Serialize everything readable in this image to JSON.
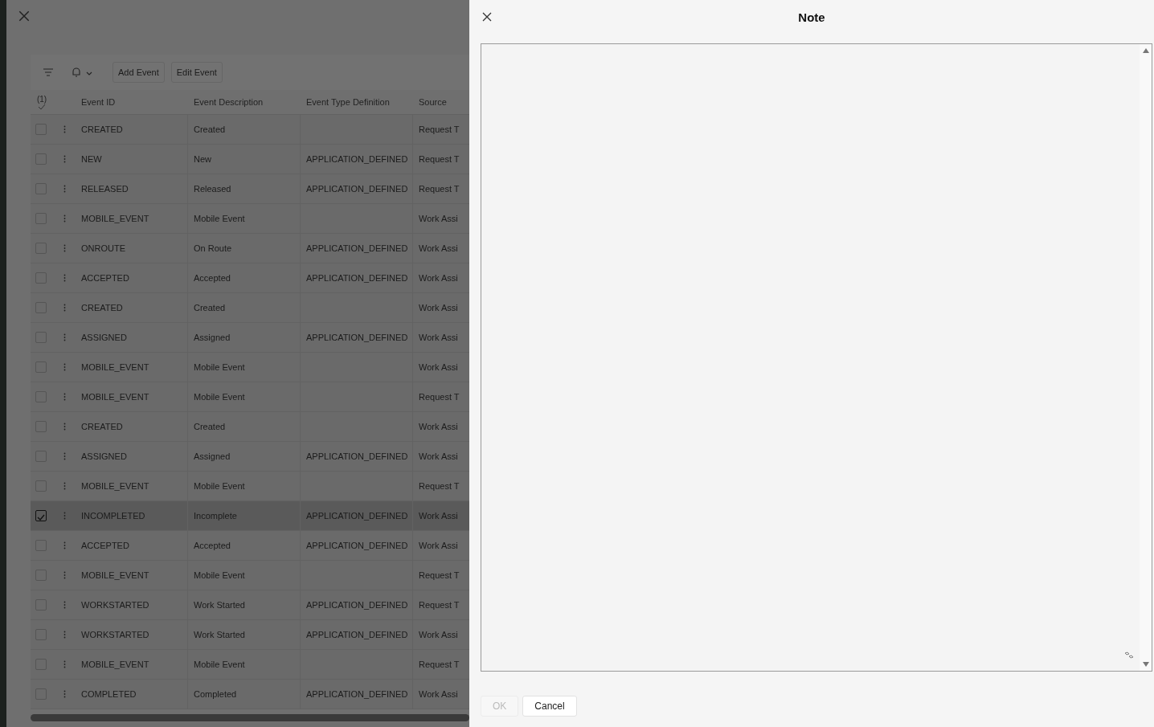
{
  "background_panel": {
    "toolbar": {
      "buttons": [
        "Add Event",
        "Edit Event"
      ]
    },
    "table": {
      "selection_count": "(1)",
      "columns": [
        "Event ID",
        "Event Description",
        "Event Type Definition",
        "Source"
      ],
      "rows": [
        {
          "event_id": "CREATED",
          "description": "Created",
          "type": "",
          "source": "Request T",
          "selected": false
        },
        {
          "event_id": "NEW",
          "description": "New",
          "type": "APPLICATION_DEFINED",
          "source": "Request T",
          "selected": false
        },
        {
          "event_id": "RELEASED",
          "description": "Released",
          "type": "APPLICATION_DEFINED",
          "source": "Request T",
          "selected": false
        },
        {
          "event_id": "MOBILE_EVENT",
          "description": "Mobile Event",
          "type": "",
          "source": "Work Assi",
          "selected": false
        },
        {
          "event_id": "ONROUTE",
          "description": "On Route",
          "type": "APPLICATION_DEFINED",
          "source": "Work Assi",
          "selected": false
        },
        {
          "event_id": "ACCEPTED",
          "description": "Accepted",
          "type": "APPLICATION_DEFINED",
          "source": "Work Assi",
          "selected": false
        },
        {
          "event_id": "CREATED",
          "description": "Created",
          "type": "",
          "source": "Work Assi",
          "selected": false
        },
        {
          "event_id": "ASSIGNED",
          "description": "Assigned",
          "type": "APPLICATION_DEFINED",
          "source": "Work Assi",
          "selected": false
        },
        {
          "event_id": "MOBILE_EVENT",
          "description": "Mobile Event",
          "type": "",
          "source": "Work Assi",
          "selected": false
        },
        {
          "event_id": "MOBILE_EVENT",
          "description": "Mobile Event",
          "type": "",
          "source": "Request T",
          "selected": false
        },
        {
          "event_id": "CREATED",
          "description": "Created",
          "type": "",
          "source": "Work Assi",
          "selected": false
        },
        {
          "event_id": "ASSIGNED",
          "description": "Assigned",
          "type": "APPLICATION_DEFINED",
          "source": "Work Assi",
          "selected": false
        },
        {
          "event_id": "MOBILE_EVENT",
          "description": "Mobile Event",
          "type": "",
          "source": "Request T",
          "selected": false
        },
        {
          "event_id": "INCOMPLETED",
          "description": "Incomplete",
          "type": "APPLICATION_DEFINED",
          "source": "Work Assi",
          "selected": true
        },
        {
          "event_id": "ACCEPTED",
          "description": "Accepted",
          "type": "APPLICATION_DEFINED",
          "source": "Work Assi",
          "selected": false
        },
        {
          "event_id": "MOBILE_EVENT",
          "description": "Mobile Event",
          "type": "",
          "source": "Request T",
          "selected": false
        },
        {
          "event_id": "WORKSTARTED",
          "description": "Work Started",
          "type": "APPLICATION_DEFINED",
          "source": "Request T",
          "selected": false
        },
        {
          "event_id": "WORKSTARTED",
          "description": "Work Started",
          "type": "APPLICATION_DEFINED",
          "source": "Work Assi",
          "selected": false
        },
        {
          "event_id": "MOBILE_EVENT",
          "description": "Mobile Event",
          "type": "",
          "source": "Request T",
          "selected": false
        },
        {
          "event_id": "COMPLETED",
          "description": "Completed",
          "type": "APPLICATION_DEFINED",
          "source": "Work Assi",
          "selected": false
        }
      ]
    }
  },
  "dialog": {
    "title": "Note",
    "buttons": [
      {
        "label": "OK",
        "disabled": true
      },
      {
        "label": "Cancel",
        "disabled": false
      }
    ]
  }
}
